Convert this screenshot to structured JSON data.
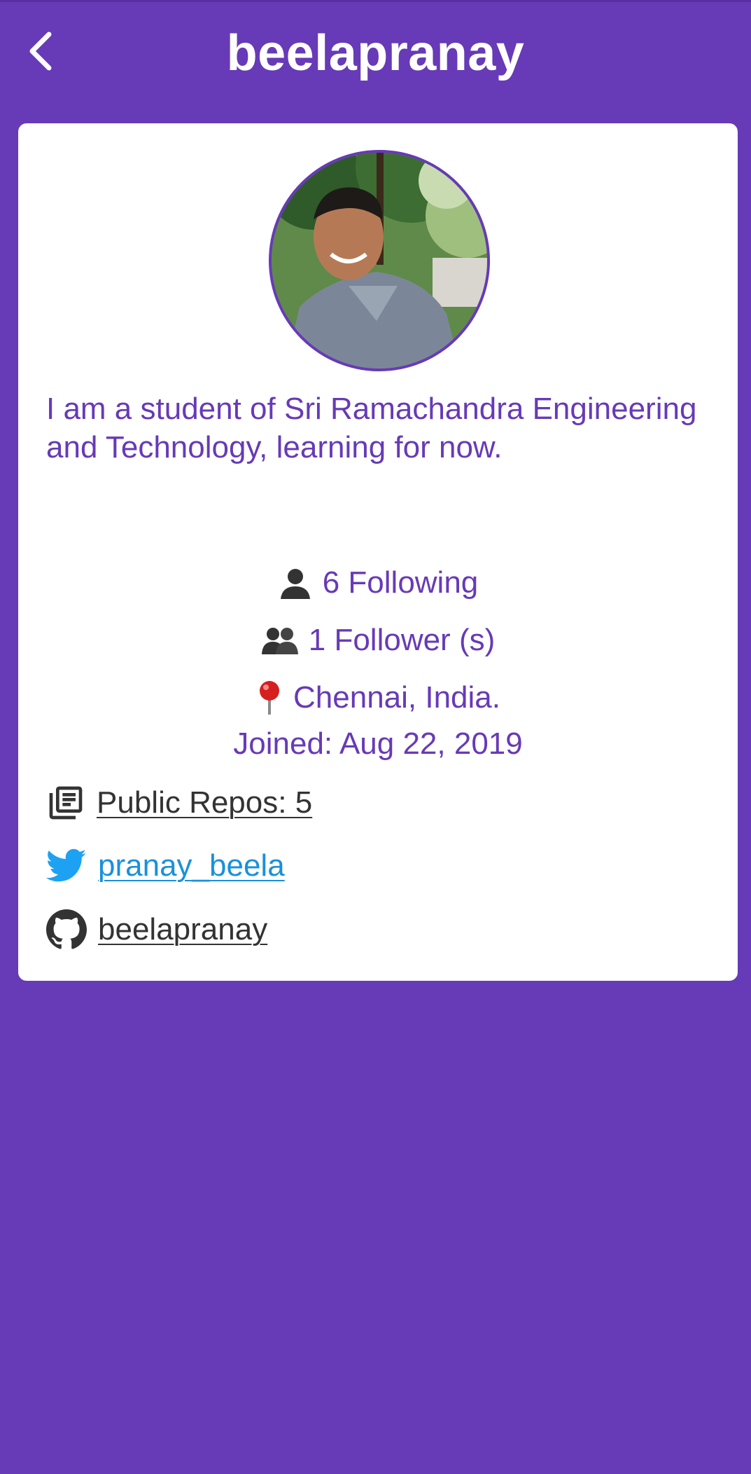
{
  "header": {
    "title": "beelapranay",
    "back_icon": "chevron-left-icon"
  },
  "profile": {
    "avatar_alt": "profile photo",
    "bio": "I am a student of Sri Ramachandra Engineering and Technology, learning for now.",
    "following": "6 Following",
    "followers": "1 Follower (s)",
    "location": "Chennai, India.",
    "joined": "Joined: Aug 22, 2019"
  },
  "links": {
    "public_repos": "Public Repos: 5",
    "twitter": "pranay_beela",
    "github": "beelapranay"
  },
  "colors": {
    "primary": "#673ab7",
    "card": "#ffffff",
    "twitter": "#1da1f2",
    "text_dark": "#333333"
  }
}
